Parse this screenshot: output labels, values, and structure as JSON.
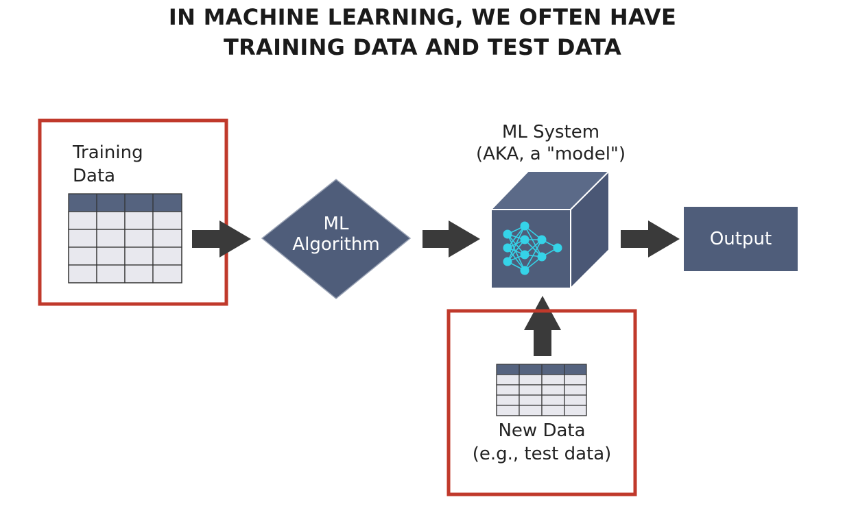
{
  "title": {
    "line1": "IN MACHINE LEARNING, WE OFTEN HAVE",
    "line2": "TRAINING DATA AND TEST DATA"
  },
  "nodes": {
    "training_data": {
      "line1": "Training",
      "line2": "Data"
    },
    "ml_algorithm": {
      "line1": "ML",
      "line2": "Algorithm"
    },
    "ml_system": {
      "line1": "ML System",
      "line2": "(AKA, a \"model\")"
    },
    "output": {
      "label": "Output"
    },
    "new_data": {
      "line1": "New Data",
      "line2": "(e.g., test data)"
    }
  },
  "colors": {
    "slate": "#4f5d7a",
    "slate_light": "#5b6a88",
    "highlight_red": "#c0392b",
    "arrow": "#3a3a3a",
    "table_cell": "#e8e8ee",
    "network_node": "#35d3e8"
  }
}
